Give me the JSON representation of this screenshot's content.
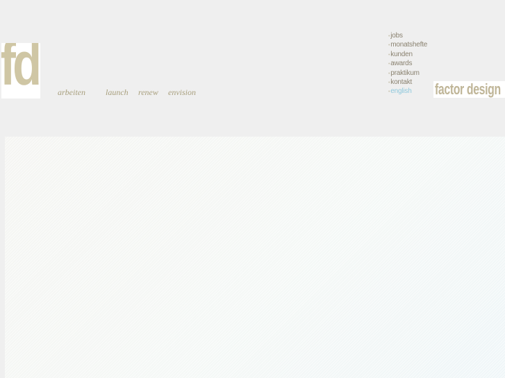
{
  "logo": {
    "text": "fd"
  },
  "main_nav": {
    "items": [
      {
        "id": "arbeiten",
        "label": "arbeiten"
      },
      {
        "id": "launch",
        "label": "launch"
      },
      {
        "id": "renew",
        "label": "renew"
      },
      {
        "id": "envision",
        "label": "envision"
      }
    ]
  },
  "side_nav": {
    "bullet": "•",
    "items": [
      {
        "id": "jobs",
        "label": "jobs"
      },
      {
        "id": "monatshefte",
        "label": "monatshefte"
      },
      {
        "id": "kunden",
        "label": "kunden"
      },
      {
        "id": "awards",
        "label": "awards"
      },
      {
        "id": "praktikum",
        "label": "praktikum"
      },
      {
        "id": "kontakt",
        "label": "kontakt"
      },
      {
        "id": "english",
        "label": "english"
      }
    ]
  },
  "brand": {
    "text": "factor design"
  },
  "colors": {
    "page_background": "#efefef",
    "logo_tan": "#cfc6a4",
    "nav_text": "#a89f7d",
    "side_nav_text": "#8a8270",
    "language_link": "#8ec8dc"
  }
}
